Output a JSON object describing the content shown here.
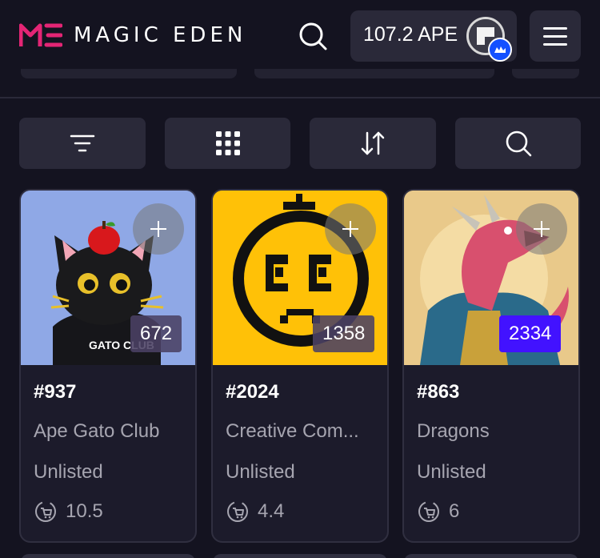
{
  "header": {
    "brand": "MAGIC EDEN",
    "balance": "107.2 APE",
    "icons": {
      "search": "search-icon",
      "menu": "hamburger-menu-icon",
      "badge": "wallet-network-badge-icon"
    }
  },
  "toolbar": {
    "buttons": [
      {
        "name": "filter-button",
        "icon": "filter-icon"
      },
      {
        "name": "grid-view-button",
        "icon": "grid-icon"
      },
      {
        "name": "sort-button",
        "icon": "sort-arrows-icon"
      },
      {
        "name": "search-button",
        "icon": "search-icon"
      }
    ]
  },
  "colors": {
    "background": "#141320",
    "surface": "#2a2939",
    "rank_highlight": "#4212ff",
    "brand_pink": "#e42575"
  },
  "cards": [
    {
      "id": "#937",
      "collection": "Ape Gato Club",
      "status": "Unlisted",
      "price": "10.5",
      "rank": "672"
    },
    {
      "id": "#2024",
      "collection": "Creative Com...",
      "status": "Unlisted",
      "price": "4.4",
      "rank": "1358"
    },
    {
      "id": "#863",
      "collection": "Dragons",
      "status": "Unlisted",
      "price": "6",
      "rank": "2334"
    }
  ]
}
